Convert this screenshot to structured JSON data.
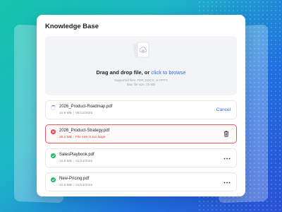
{
  "card": {
    "title": "Knowledge Base"
  },
  "dropzone": {
    "icon": "file-upload-icon",
    "title_prefix": "Drag and drop file, or ",
    "browse_link": "click to browse",
    "supported": "Supported files: PDF, DOCX, or PPTX",
    "max_size": "Max file size: 25 MB"
  },
  "files": [
    {
      "name": "2026_Product-Roadmap.pdf",
      "size": "10.8 MB",
      "date": "08/12/2025",
      "status": "uploading",
      "action": "Cancel"
    },
    {
      "name": "2026_Product-Strategy.pdf",
      "size": "30.2 MB",
      "error": "File size is too large",
      "status": "error",
      "action_icon": "trash-icon"
    },
    {
      "name": "SalesPlaybook.pdf",
      "size": "10.8 MB",
      "date": "01/24/2025",
      "status": "done",
      "action_icon": "more-icon"
    },
    {
      "name": "New-Pricing.pdf",
      "size": "10.8 MB",
      "date": "01/24/2025",
      "status": "done",
      "action_icon": "more-icon"
    }
  ],
  "colors": {
    "accent": "#2b6ee8",
    "success": "#26b36b",
    "error": "#e24b4b"
  }
}
